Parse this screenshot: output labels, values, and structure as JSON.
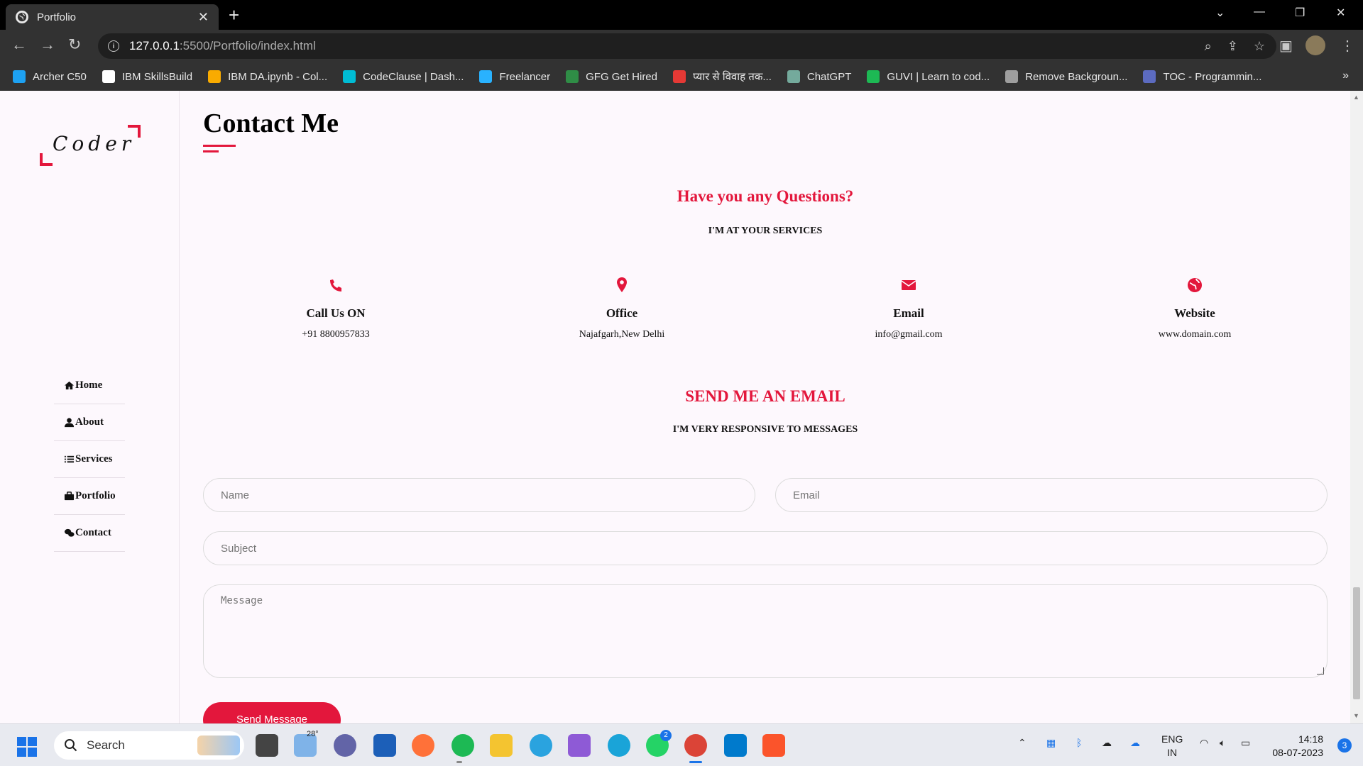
{
  "browser": {
    "tab_title": "Portfolio",
    "url_host": "127.0.0.1",
    "url_path": ":5500/Portfolio/index.html",
    "bookmarks": [
      {
        "label": "Archer C50",
        "color": "#1da1f2"
      },
      {
        "label": "IBM SkillsBuild",
        "color": "#ffffff"
      },
      {
        "label": "IBM DA.ipynb - Col...",
        "color": "#f9ab00"
      },
      {
        "label": "CodeClause | Dash...",
        "color": "#00bcd4"
      },
      {
        "label": "Freelancer",
        "color": "#29b2fe"
      },
      {
        "label": "GFG Get Hired",
        "color": "#2f8d46"
      },
      {
        "label": "प्यार से विवाह तक...",
        "color": "#e53935"
      },
      {
        "label": "ChatGPT",
        "color": "#74aa9c"
      },
      {
        "label": "GUVI | Learn to cod...",
        "color": "#1db954"
      },
      {
        "label": "Remove Backgroun...",
        "color": "#9e9e9e"
      },
      {
        "label": "TOC - Programmin...",
        "color": "#5c6bc0"
      }
    ]
  },
  "sidebar": {
    "logo_text": "Coder",
    "nav": [
      {
        "label": "Home",
        "icon": "home-icon"
      },
      {
        "label": "About",
        "icon": "user-icon"
      },
      {
        "label": "Services",
        "icon": "list-icon"
      },
      {
        "label": "Portfolio",
        "icon": "briefcase-icon"
      },
      {
        "label": "Contact",
        "icon": "comments-icon"
      }
    ]
  },
  "contact": {
    "title": "Contact Me",
    "questions_title": "Have you any Questions?",
    "questions_sub": "I'M AT YOUR SERVICES",
    "cards": [
      {
        "icon": "phone-icon",
        "label": "Call Us ON",
        "value": "+91 8800957833"
      },
      {
        "icon": "location-pin-icon",
        "label": "Office",
        "value": "Najafgarh,New Delhi"
      },
      {
        "icon": "envelope-icon",
        "label": "Email",
        "value": "info@gmail.com"
      },
      {
        "icon": "globe-icon",
        "label": "Website",
        "value": "www.domain.com"
      }
    ],
    "email_title": "SEND ME AN EMAIL",
    "email_sub": "I'M VERY RESPONSIVE TO MESSAGES",
    "form": {
      "name_placeholder": "Name",
      "email_placeholder": "Email",
      "subject_placeholder": "Subject",
      "message_placeholder": "Message",
      "send_label": "Send Message"
    }
  },
  "taskbar": {
    "search_label": "Search",
    "weather_temp": "28°",
    "whatsapp_badge": "2",
    "language": "ENG",
    "region": "IN",
    "time": "14:18",
    "date": "08-07-2023",
    "notifications": "3"
  },
  "colors": {
    "accent": "#e3173c",
    "page_bg": "#fdf8fd"
  }
}
